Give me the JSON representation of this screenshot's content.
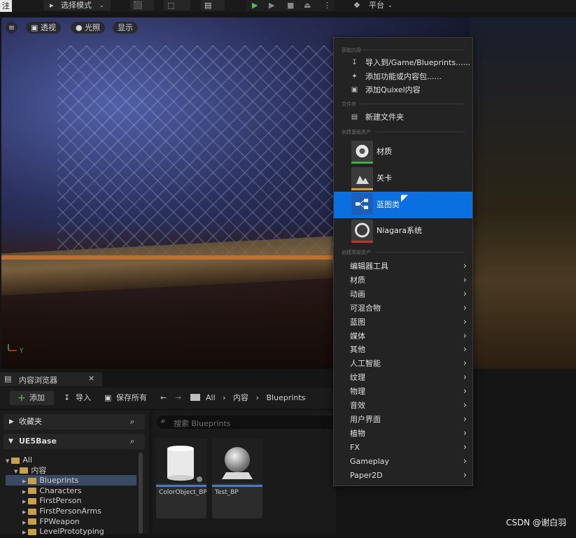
{
  "toolbar": {
    "corner_label": "注",
    "mode_label": "选择模式",
    "platform_label": "平台"
  },
  "viewport": {
    "perspective_label": "透视",
    "lighting_label": "光照",
    "show_label": "显示"
  },
  "menu": {
    "section_get": "获取内容",
    "import_label": "导入到/Game/Blueprints......",
    "add_feature_label": "添加功能或内容包......",
    "add_quixel_label": "添加Quixel内容",
    "section_folder": "文件夹",
    "new_folder_label": "新建文件夹",
    "section_basic": "创建基础资产",
    "basic_items": [
      {
        "label": "材质",
        "stripe": "#3fae3f"
      },
      {
        "label": "关卡",
        "stripe": "#e09a2a"
      },
      {
        "label": "蓝图类",
        "stripe": "#2f7fd8"
      },
      {
        "label": "Niagara系统",
        "stripe": "#c83030"
      }
    ],
    "section_advanced": "创建高级资产",
    "sub_items": [
      "编辑器工具",
      "材质",
      "动画",
      "可混合物",
      "蓝图",
      "媒体",
      "其他",
      "人工智能",
      "纹理",
      "物理",
      "音效",
      "用户界面",
      "植物",
      "FX",
      "Gameplay",
      "Paper2D"
    ],
    "highlight_color": "#0a70e0"
  },
  "content_browser": {
    "tab_label": "内容浏览器",
    "close_glyph": "×",
    "add_label": "添加",
    "import_label": "导入",
    "save_all_label": "保存所有",
    "breadcrumb": [
      "All",
      "内容",
      "Blueprints"
    ],
    "favorites_label": "收藏夹",
    "project_label": "UE5Base",
    "search_placeholder": "搜索 Blueprints",
    "tree": [
      {
        "label": "All",
        "depth": 0,
        "selected": false
      },
      {
        "label": "内容",
        "depth": 1,
        "selected": false
      },
      {
        "label": "Blueprints",
        "depth": 2,
        "selected": true
      },
      {
        "label": "Characters",
        "depth": 2,
        "selected": false
      },
      {
        "label": "FirstPerson",
        "depth": 2,
        "selected": false
      },
      {
        "label": "FirstPersonArms",
        "depth": 2,
        "selected": false
      },
      {
        "label": "FPWeapon",
        "depth": 2,
        "selected": false
      },
      {
        "label": "LevelPrototyping",
        "depth": 2,
        "selected": false
      }
    ],
    "assets": [
      "ColorObject_BP",
      "Test_BP"
    ]
  },
  "watermark": "CSDN @谢白羽"
}
